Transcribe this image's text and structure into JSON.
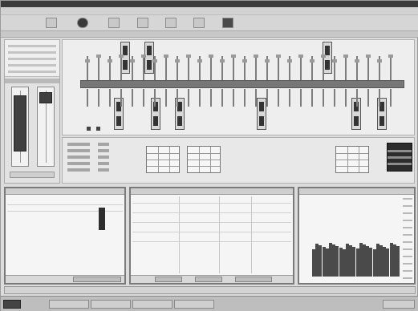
{
  "window": {
    "title": ""
  },
  "menu": {
    "items": []
  },
  "toolbar": {
    "buttons": []
  },
  "left_panel": {
    "rows": []
  },
  "schematic": {
    "labels": []
  },
  "info": {
    "rows": []
  },
  "bottom_panels": {
    "left": {
      "title": ""
    },
    "middle": {
      "title": ""
    },
    "right": {
      "title": ""
    }
  },
  "taskbar": {
    "tasks": []
  }
}
